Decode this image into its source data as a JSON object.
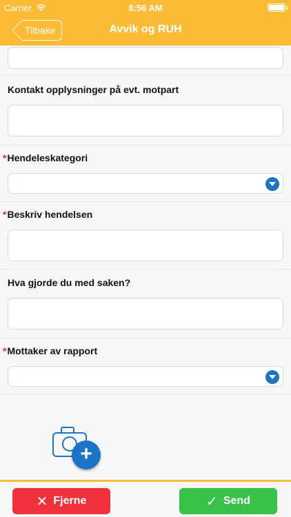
{
  "status_bar": {
    "carrier": "Carrier",
    "time": "8:56 AM",
    "battery_level": 1.0
  },
  "nav": {
    "back_label": "Tilbake",
    "title": "Avvik og RUH"
  },
  "form": {
    "contact_label": "Kontakt opplysninger på evt. motpart",
    "category_label": "Hendeleskategori",
    "describe_label": "Beskriv hendelsen",
    "action_label": "Hva gjorde du med saken?",
    "recipient_label": "Mottaker av rapport",
    "required_mark": "*"
  },
  "buttons": {
    "remove_label": "Fjerne",
    "remove_glyph": "✕",
    "send_label": "Send",
    "send_glyph": "✓"
  },
  "icons": {
    "camera": "add-photo-icon",
    "plus": "+"
  },
  "colors": {
    "accent": "#fbbb34",
    "primary": "#1b74c6",
    "danger": "#f0323d",
    "success": "#38c24a"
  }
}
